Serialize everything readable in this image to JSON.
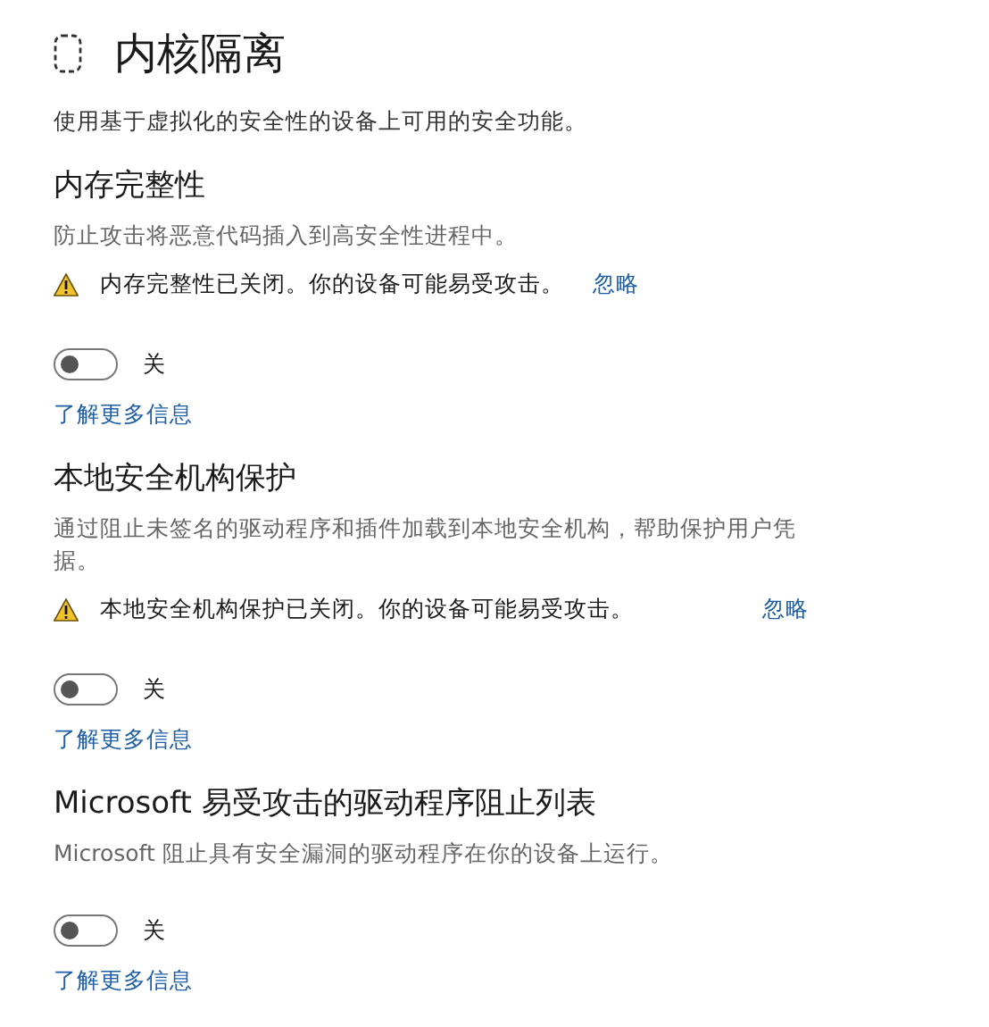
{
  "page": {
    "title": "内核隔离",
    "description": "使用基于虚拟化的安全性的设备上可用的安全功能。"
  },
  "sections": [
    {
      "heading": "内存完整性",
      "description": "防止攻击将恶意代码插入到高安全性进程中。",
      "warning": {
        "text": "内存完整性已关闭。你的设备可能易受攻击。",
        "dismiss": "忽略"
      },
      "toggle": {
        "on": false,
        "label": "关"
      },
      "link": "了解更多信息"
    },
    {
      "heading": "本地安全机构保护",
      "description": "通过阻止未签名的驱动程序和插件加载到本地安全机构，帮助保护用户凭据。",
      "warning": {
        "text": "本地安全机构保护已关闭。你的设备可能易受攻击。",
        "dismiss": "忽略"
      },
      "toggle": {
        "on": false,
        "label": "关"
      },
      "link": "了解更多信息"
    },
    {
      "heading": "Microsoft 易受攻击的驱动程序阻止列表",
      "description": "Microsoft 阻止具有安全漏洞的驱动程序在你的设备上运行。",
      "toggle": {
        "on": false,
        "label": "关"
      },
      "link": "了解更多信息"
    }
  ]
}
